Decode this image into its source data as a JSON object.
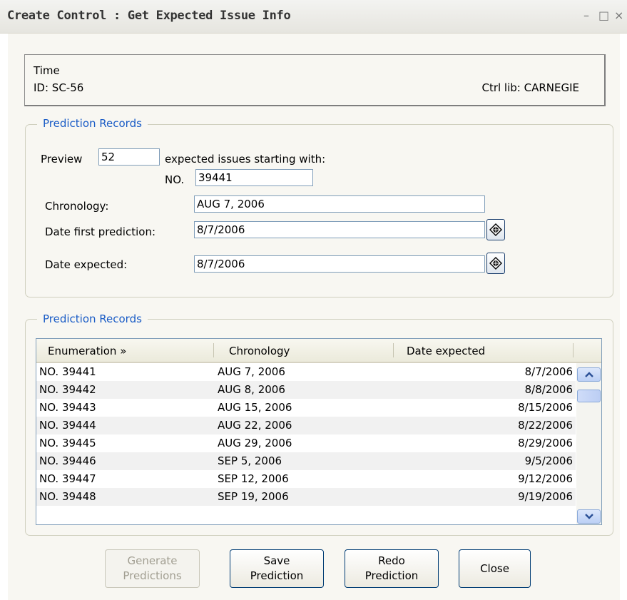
{
  "window": {
    "title": "Create Control : Get Expected Issue Info",
    "minimize_glyph": "–",
    "maximize_glyph": "□",
    "close_glyph": "×"
  },
  "header": {
    "title": "Time",
    "id_text": "ID: SC-56",
    "ctrl_lib": "Ctrl lib: CARNEGIE"
  },
  "prediction_form": {
    "legend": "Prediction Records",
    "preview_label": "Preview",
    "preview_value": "52",
    "starting_label": "expected issues starting with:",
    "no_label": "NO.",
    "no_value": "39441",
    "chronology_label": "Chronology:",
    "chronology_value": "AUG 7, 2006",
    "date_first_label": "Date first prediction:",
    "date_first_value": "8/7/2006",
    "date_expected_label": "Date expected:",
    "date_expected_value": "8/7/2006",
    "calendar_icon": "calendar-icon"
  },
  "prediction_table": {
    "legend": "Prediction Records",
    "columns": [
      "Enumeration »",
      "Chronology",
      "Date expected"
    ],
    "rows": [
      [
        "NO. 39441",
        "AUG 7, 2006",
        "8/7/2006"
      ],
      [
        "NO. 39442",
        "AUG 8, 2006",
        "8/8/2006"
      ],
      [
        "NO. 39443",
        "AUG 15, 2006",
        "8/15/2006"
      ],
      [
        "NO. 39444",
        "AUG 22, 2006",
        "8/22/2006"
      ],
      [
        "NO. 39445",
        "AUG 29, 2006",
        "8/29/2006"
      ],
      [
        "NO. 39446",
        "SEP 5, 2006",
        "9/5/2006"
      ],
      [
        "NO. 39447",
        "SEP 12, 2006",
        "9/12/2006"
      ],
      [
        "NO. 39448",
        "SEP 19, 2006",
        "9/19/2006"
      ]
    ]
  },
  "buttons": {
    "generate": "Generate\nPredictions",
    "save": "Save\nPrediction",
    "redo": "Redo\nPrediction",
    "close": "Close"
  },
  "colors": {
    "accent_text": "#1a5cc6",
    "button_border": "#003c74",
    "input_border": "#7f9db9"
  }
}
